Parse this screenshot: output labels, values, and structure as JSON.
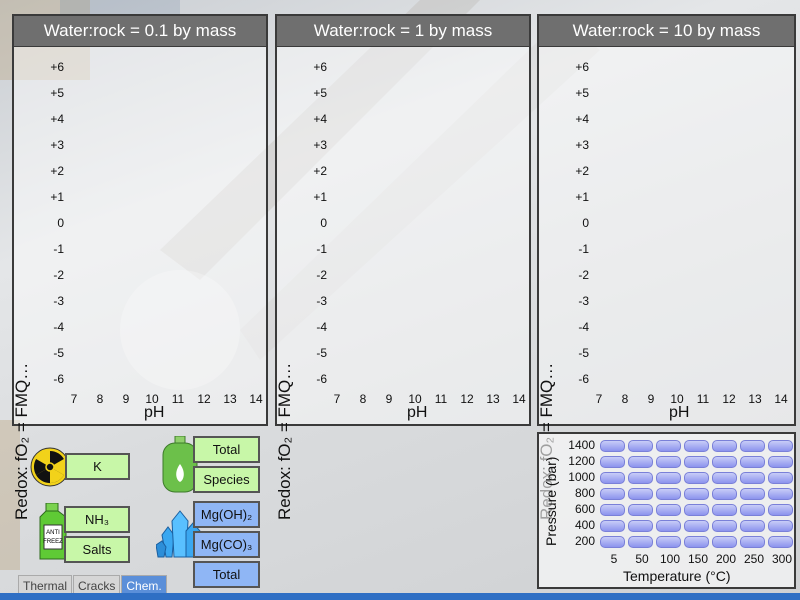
{
  "panels": [
    {
      "title": "Water:rock = 0.1 by mass"
    },
    {
      "title": "Water:rock = 1 by mass"
    },
    {
      "title": "Water:rock = 10 by mass"
    }
  ],
  "axes": {
    "ylabel": "Redox: fO₂ = FMQ…",
    "yticks": [
      "+6",
      "+5",
      "+4",
      "+3",
      "+2",
      "+1",
      "0",
      "-1",
      "-2",
      "-3",
      "-4",
      "-5",
      "-6"
    ],
    "xticks": [
      "7",
      "8",
      "9",
      "10",
      "11",
      "12",
      "13",
      "14"
    ],
    "xlabel": "pH"
  },
  "controls": {
    "k": "K",
    "total": "Total",
    "species": "Species",
    "nh3": "NH₃",
    "salts": "Salts",
    "mgoh2": "Mg(OH)₂",
    "mgco3": "Mg(CO)₃",
    "total2": "Total"
  },
  "icons": {
    "radiation": "radiation-icon",
    "gas": "gas-cylinder-icon",
    "antifreeze": "antifreeze-bottle-icon",
    "crystal": "crystal-icon",
    "antifreeze_text": "ANTI FREEZ"
  },
  "pt_grid": {
    "ylabel": "Pressure (bar)",
    "xlabel": "Temperature (°C)",
    "pressures": [
      "1400",
      "1200",
      "1000",
      "800",
      "600",
      "400",
      "200"
    ],
    "temperatures": [
      "5",
      "50",
      "100",
      "150",
      "200",
      "250",
      "300"
    ],
    "cell_color": "#9aa0f0"
  },
  "tabs": [
    {
      "label": "Thermal",
      "active": false
    },
    {
      "label": "Cracks",
      "active": false
    },
    {
      "label": "Chem.",
      "active": true
    }
  ]
}
